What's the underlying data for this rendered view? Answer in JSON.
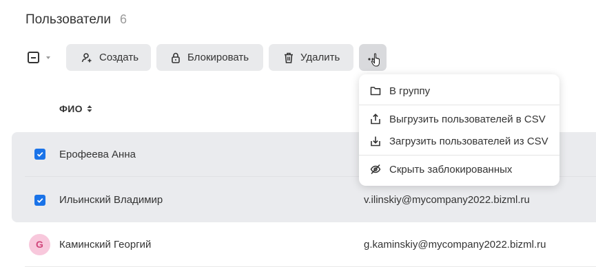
{
  "header": {
    "title": "Пользователи",
    "count": "6"
  },
  "toolbar": {
    "create_label": "Создать",
    "block_label": "Блокировать",
    "delete_label": "Удалить",
    "more_icon": "more-dots-icon"
  },
  "table": {
    "columns": {
      "fio": "ФИО"
    },
    "rows": [
      {
        "name": "Ерофеева Анна",
        "email": "",
        "selected": true
      },
      {
        "name": "Ильинский Владимир",
        "email": "v.ilinskiy@mycompany2022.bizml.ru",
        "selected": true
      },
      {
        "name": "Каминский Георгий",
        "email": "g.kaminskiy@mycompany2022.bizml.ru",
        "selected": false,
        "avatar_letter": "G"
      }
    ]
  },
  "menu": {
    "items": [
      {
        "label": "В группу",
        "icon": "folder-icon"
      },
      {
        "label": "Выгрузить пользователей в CSV",
        "icon": "upload-icon"
      },
      {
        "label": "Загрузить пользователей из CSV",
        "icon": "download-icon"
      },
      {
        "label": "Скрыть заблокированных",
        "icon": "eye-off-icon"
      }
    ]
  },
  "colors": {
    "accent": "#1a73e8",
    "button_bg": "#e9eaec",
    "selected_row_bg": "#eaebee",
    "avatar_bg": "#f8c8dc",
    "avatar_text": "#d0457a"
  }
}
